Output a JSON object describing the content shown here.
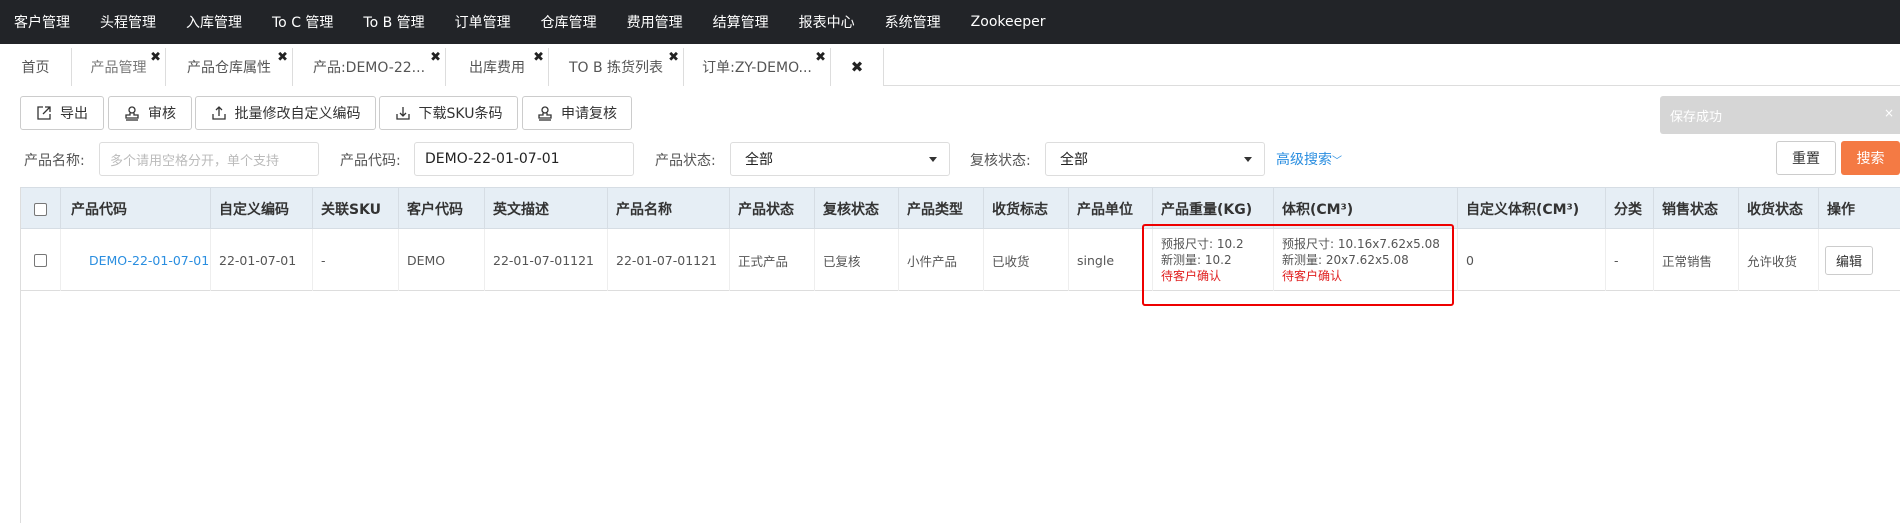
{
  "topnav": [
    "客户管理",
    "头程管理",
    "入库管理",
    "To C 管理",
    "To B 管理",
    "订单管理",
    "仓库管理",
    "费用管理",
    "结算管理",
    "报表中心",
    "系统管理",
    "Zookeeper"
  ],
  "tabs": [
    {
      "label": "首页",
      "closable": false
    },
    {
      "label": "产品管理",
      "closable": true,
      "active": true
    },
    {
      "label": "产品仓库属性",
      "closable": true
    },
    {
      "label": "产品:DEMO-22...",
      "closable": true
    },
    {
      "label": "出库费用",
      "closable": true
    },
    {
      "label": "TO B 拣货列表",
      "closable": true
    },
    {
      "label": "订单:ZY-DEMO...",
      "closable": true
    }
  ],
  "tab_close_all": "✖",
  "toolbar": {
    "export": "导出",
    "audit": "审核",
    "batch_edit": "批量修改自定义编码",
    "download_sku": "下载SKU条码",
    "apply_recheck": "申请复核"
  },
  "toast": {
    "text": "保存成功",
    "close": "×"
  },
  "filters": {
    "name_label": "产品名称:",
    "name_placeholder": "多个请用空格分开，单个支持",
    "code_label": "产品代码:",
    "code_value": "DEMO-22-01-07-01",
    "status_label": "产品状态:",
    "status_value": "全部",
    "recheck_label": "复核状态:",
    "recheck_value": "全部",
    "advanced": "高级搜索",
    "reset": "重置",
    "search": "搜索"
  },
  "table": {
    "headers": [
      "产品代码",
      "自定义编码",
      "关联SKU",
      "客户代码",
      "英文描述",
      "产品名称",
      "产品状态",
      "复核状态",
      "产品类型",
      "收货标志",
      "产品单位",
      "产品重量(KG)",
      "体积(CM³)",
      "自定义体积(CM³)",
      "分类",
      "销售状态",
      "收货状态",
      "操作"
    ],
    "row": {
      "code": "DEMO-22-01-07-01",
      "custom_code": "22-01-07-01",
      "linked_sku": "-",
      "customer": "DEMO",
      "en_desc": "22-01-07-01121",
      "name": "22-01-07-01121",
      "status": "正式产品",
      "recheck": "已复核",
      "type": "小件产品",
      "receipt_flag": "已收货",
      "unit": "single",
      "weight": {
        "reported": "预报尺寸: 10.2",
        "measured": "新测量: 10.2",
        "pending": "待客户确认"
      },
      "volume": {
        "reported": "预报尺寸: 10.16x7.62x5.08",
        "measured": "新测量: 20x7.62x5.08",
        "pending": "待客户确认"
      },
      "custom_volume": "0",
      "category": "-",
      "sale_status": "正常销售",
      "receive_status": "允许收货",
      "action": "编辑"
    }
  }
}
